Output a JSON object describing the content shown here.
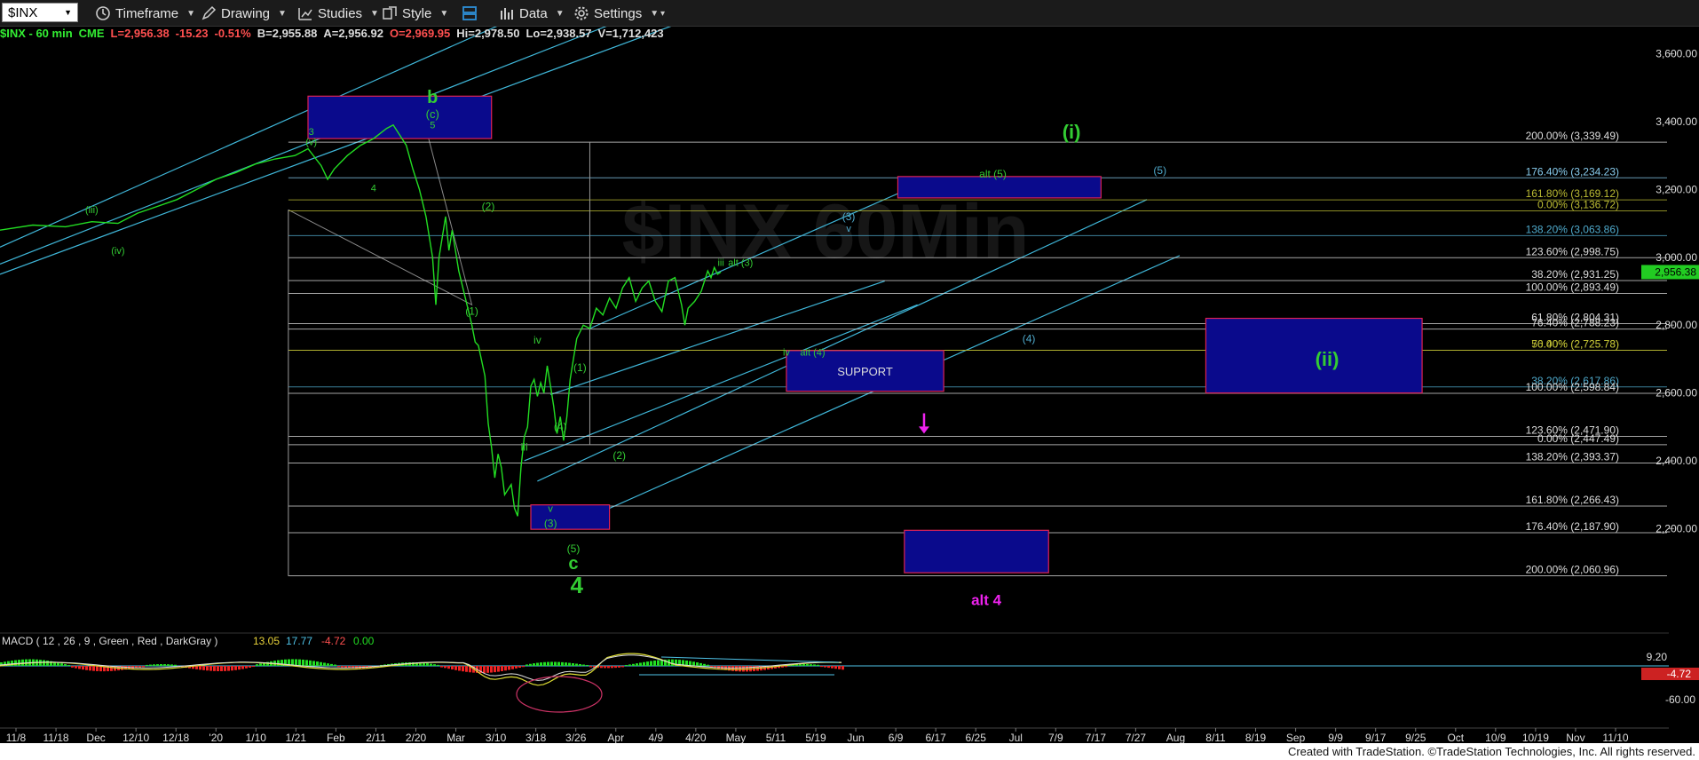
{
  "toolbar": {
    "symbol": "$INX",
    "items": [
      {
        "label": "Timeframe",
        "icon": "clock-icon"
      },
      {
        "label": "Drawing",
        "icon": "pencil-icon"
      },
      {
        "label": "Studies",
        "icon": "studies-icon"
      },
      {
        "label": "Style",
        "icon": "style-icon"
      },
      {
        "label": "Data",
        "icon": "data-icon"
      },
      {
        "label": "Settings",
        "icon": "gear-icon"
      }
    ]
  },
  "infobar": {
    "symbol": "$INX - 60 min",
    "exchange": "CME",
    "last": "L=2,956.38",
    "change": "-15.23",
    "pct": "-0.51%",
    "bid": "B=2,955.88",
    "ask": "A=2,956.92",
    "open": "O=2,969.95",
    "high": "Hi=2,978.50",
    "low": "Lo=2,938.57",
    "volume": "V=1,712,423",
    "colors": {
      "symbol": "#33ee33",
      "last": "#ff5050",
      "bid": "#dddddd",
      "open": "#ff5050"
    }
  },
  "watermark": "$INX 60Min",
  "footer": "Created with TradeStation. ©TradeStation Technologies, Inc. All rights reserved.",
  "macd": {
    "label": "MACD ( 12 , 26 , 9 , Green , Red , DarkGray )",
    "v1": "13.05",
    "v2": "17.77",
    "v3": "-4.72",
    "v4": "0.00",
    "axis_labels": [
      "9.20",
      "-60.00"
    ],
    "last_badge": "-4.72",
    "colors": {
      "line": "#dddd33",
      "signal": "#dddddd",
      "hist_pos": "#22dd22",
      "hist_neg": "#ee2222"
    }
  },
  "chart_data": {
    "type": "line",
    "y_axis": {
      "min": 1900,
      "max": 3680,
      "ticks": [
        2200,
        2400,
        2600,
        2800,
        3000,
        3200,
        3400,
        3600
      ],
      "tick_labels": [
        "2,200.00",
        "2,400.00",
        "2,600.00",
        "2,800.00",
        "3,000.00",
        "3,200.00",
        "3,400.00",
        "3,600.00"
      ]
    },
    "x_axis": {
      "tick_labels": [
        "11/8",
        "11/18",
        "Dec",
        "12/10",
        "12/18",
        "'20",
        "1/10",
        "1/21",
        "Feb",
        "2/11",
        "2/20",
        "Mar",
        "3/10",
        "3/18",
        "3/26",
        "Apr",
        "4/9",
        "4/20",
        "May",
        "5/11",
        "5/19",
        "Jun",
        "6/9",
        "6/17",
        "6/25",
        "Jul",
        "7/9",
        "7/17",
        "7/27",
        "Aug",
        "8/11",
        "8/19",
        "Sep",
        "9/9",
        "9/17",
        "9/25",
        "Oct",
        "10/9",
        "10/19",
        "Nov",
        "11/10"
      ]
    },
    "last_price": {
      "value": 2956.38,
      "label": "2,956.38",
      "color": "#22cc22"
    },
    "price_series": {
      "color": "#22dd22",
      "points": [
        [
          0,
          3080
        ],
        [
          5,
          3095
        ],
        [
          10,
          3090
        ],
        [
          14,
          3105
        ],
        [
          18,
          3100
        ],
        [
          21,
          3130
        ],
        [
          24,
          3150
        ],
        [
          27,
          3170
        ],
        [
          30,
          3200
        ],
        [
          33,
          3230
        ],
        [
          36,
          3250
        ],
        [
          39,
          3275
        ],
        [
          42,
          3290
        ],
        [
          45,
          3300
        ],
        [
          47,
          3320
        ],
        [
          49,
          3270
        ],
        [
          50,
          3230
        ],
        [
          51,
          3260
        ],
        [
          53,
          3300
        ],
        [
          55,
          3330
        ],
        [
          57,
          3350
        ],
        [
          59,
          3380
        ],
        [
          60,
          3390
        ],
        [
          61,
          3360
        ],
        [
          62,
          3330
        ],
        [
          63,
          3260
        ],
        [
          64,
          3200
        ],
        [
          65,
          3120
        ],
        [
          66,
          3000
        ],
        [
          66.5,
          2860
        ],
        [
          67,
          3000
        ],
        [
          68,
          3120
        ],
        [
          68.5,
          3020
        ],
        [
          69,
          3080
        ],
        [
          70,
          2960
        ],
        [
          71,
          2880
        ],
        [
          72,
          2800
        ],
        [
          72.5,
          2750
        ],
        [
          73,
          2740
        ],
        [
          74,
          2650
        ],
        [
          74.5,
          2510
        ],
        [
          75,
          2440
        ],
        [
          75.5,
          2350
        ],
        [
          76,
          2420
        ],
        [
          76.5,
          2380
        ],
        [
          77,
          2300
        ],
        [
          78,
          2330
        ],
        [
          78.5,
          2260
        ],
        [
          79,
          2237
        ],
        [
          79.5,
          2380
        ],
        [
          80,
          2470
        ],
        [
          80.5,
          2500
        ],
        [
          81,
          2620
        ],
        [
          81.5,
          2640
        ],
        [
          82,
          2590
        ],
        [
          82.5,
          2630
        ],
        [
          83,
          2600
        ],
        [
          83.5,
          2680
        ],
        [
          84,
          2620
        ],
        [
          84.5,
          2560
        ],
        [
          85,
          2480
        ],
        [
          85.5,
          2530
        ],
        [
          86,
          2460
        ],
        [
          86.5,
          2530
        ],
        [
          87,
          2640
        ],
        [
          88,
          2760
        ],
        [
          89,
          2800
        ],
        [
          90,
          2790
        ],
        [
          91,
          2850
        ],
        [
          92,
          2830
        ],
        [
          93,
          2880
        ],
        [
          94,
          2850
        ],
        [
          95,
          2910
        ],
        [
          96,
          2940
        ],
        [
          97,
          2870
        ],
        [
          98,
          2910
        ],
        [
          99,
          2930
        ],
        [
          100,
          2870
        ],
        [
          101,
          2840
        ],
        [
          102,
          2930
        ],
        [
          103,
          2940
        ],
        [
          104,
          2860
        ],
        [
          104.5,
          2800
        ],
        [
          105,
          2850
        ],
        [
          106,
          2870
        ],
        [
          107,
          2900
        ],
        [
          108,
          2960
        ],
        [
          108.5,
          2940
        ],
        [
          109,
          2970
        ],
        [
          109.5,
          2950
        ],
        [
          110,
          2956.38
        ]
      ]
    },
    "fib_levels": [
      {
        "label": "200.00% (3,339.49)",
        "value": 3339.49,
        "color": "#dddddd"
      },
      {
        "label": "176.40% (3,234.23)",
        "value": 3234.23,
        "color": "#88ccee"
      },
      {
        "label": "161.80% (3,169.12)",
        "value": 3169.12,
        "color": "#bbbb33"
      },
      {
        "label": "0.00% (3,136.72)",
        "value": 3136.72,
        "color": "#bbbb33"
      },
      {
        "label": "138.20% (3,063.86)",
        "value": 3063.86,
        "color": "#4faacc"
      },
      {
        "label": "123.60% (2,998.75)",
        "value": 2998.75,
        "color": "#dddddd"
      },
      {
        "label": "38.20% (2,931.25)",
        "value": 2931.25,
        "color": "#dddddd"
      },
      {
        "label": "100.00% (2,893.49)",
        "value": 2893.49,
        "color": "#dddddd"
      },
      {
        "label": "61.80% (2,804.31)",
        "value": 2804.31,
        "color": "#dddddd"
      },
      {
        "label": "76.40% (2,788.23)",
        "value": 2788.23,
        "color": "#dddddd"
      },
      {
        "label": "76.40% (2,725.73)",
        "value": 2725.73,
        "color": "#bbbb33"
      },
      {
        "label": "50.00% (2,725.78)",
        "value": 2725.78,
        "color": "#bbbb33"
      },
      {
        "label": "38.20% (2,617.86)",
        "value": 2617.86,
        "color": "#4faacc"
      },
      {
        "label": "100.00% (2,598.84)",
        "value": 2598.84,
        "color": "#dddddd"
      },
      {
        "label": "123.60% (2,471.90)",
        "value": 2471.9,
        "color": "#dddddd"
      },
      {
        "label": "0.00% (2,447.49)",
        "value": 2447.49,
        "color": "#dddddd"
      },
      {
        "label": "138.20% (2,393.37)",
        "value": 2393.37,
        "color": "#dddddd"
      },
      {
        "label": "161.80% (2,266.43)",
        "value": 2266.43,
        "color": "#dddddd"
      },
      {
        "label": "176.40% (2,187.90)",
        "value": 2187.9,
        "color": "#dddddd"
      },
      {
        "label": "200.00% (2,060.96)",
        "value": 2060.96,
        "color": "#dddddd"
      }
    ],
    "boxes": [
      {
        "name": "b-top-box",
        "x0": 47,
        "x1": 75,
        "y0": 3350,
        "y1": 3475,
        "label": ""
      },
      {
        "name": "alt5-target-box",
        "x0": 137,
        "x1": 168,
        "y0": 3175,
        "y1": 3238,
        "label": ""
      },
      {
        "name": "support-box",
        "x0": 120,
        "x1": 144,
        "y0": 2605,
        "y1": 2725,
        "label": "SUPPORT"
      },
      {
        "name": "wave-ii-box",
        "x0": 184,
        "x1": 217,
        "y0": 2600,
        "y1": 2820,
        "label": ""
      },
      {
        "name": "low-box",
        "x0": 81,
        "x1": 93,
        "y0": 2198,
        "y1": 2270,
        "label": ""
      },
      {
        "name": "alt4-box",
        "x0": 138,
        "x1": 160,
        "y0": 2070,
        "y1": 2195,
        "label": ""
      }
    ],
    "wave_labels": [
      {
        "text": "b",
        "x": 66,
        "y": 3455,
        "color": "#33cc33",
        "size": 20
      },
      {
        "text": "(c)",
        "x": 66,
        "y": 3410,
        "color": "#33cc33",
        "size": 13
      },
      {
        "text": "5",
        "x": 66,
        "y": 3380,
        "color": "#33cc33",
        "size": 11
      },
      {
        "text": "3",
        "x": 47.5,
        "y": 3360,
        "color": "#33cc33",
        "size": 11
      },
      {
        "text": "(v)",
        "x": 47.5,
        "y": 3330,
        "color": "#33cc33",
        "size": 11
      },
      {
        "text": "4",
        "x": 57,
        "y": 3195,
        "color": "#33cc33",
        "size": 11
      },
      {
        "text": "(iii)",
        "x": 14,
        "y": 3130,
        "color": "#33cc33",
        "size": 11
      },
      {
        "text": "(iv)",
        "x": 18,
        "y": 3010,
        "color": "#33cc33",
        "size": 11
      },
      {
        "text": "(2)",
        "x": 74.5,
        "y": 3140,
        "color": "#33cc33",
        "size": 12
      },
      {
        "text": "(1)",
        "x": 72,
        "y": 2830,
        "color": "#33cc33",
        "size": 12
      },
      {
        "text": "iv",
        "x": 82,
        "y": 2745,
        "color": "#33cc33",
        "size": 12
      },
      {
        "text": "(1)",
        "x": 88.5,
        "y": 2665,
        "color": "#33cc33",
        "size": 12
      },
      {
        "text": "(4)",
        "x": 85.5,
        "y": 2490,
        "color": "#33cc33",
        "size": 12
      },
      {
        "text": "iii",
        "x": 80,
        "y": 2430,
        "color": "#33cc33",
        "size": 12
      },
      {
        "text": "(2)",
        "x": 94.5,
        "y": 2405,
        "color": "#33cc33",
        "size": 12
      },
      {
        "text": "v",
        "x": 84,
        "y": 2250,
        "color": "#33cc33",
        "size": 11
      },
      {
        "text": "(3)",
        "x": 84,
        "y": 2205,
        "color": "#33cc33",
        "size": 12
      },
      {
        "text": "(5)",
        "x": 87.5,
        "y": 2130,
        "color": "#33cc33",
        "size": 12
      },
      {
        "text": "c",
        "x": 87.5,
        "y": 2080,
        "color": "#33cc33",
        "size": 20
      },
      {
        "text": "4",
        "x": 88,
        "y": 2010,
        "color": "#33cc33",
        "size": 26
      },
      {
        "text": "iii",
        "x": 110,
        "y": 2975,
        "color": "#33cc33",
        "size": 11
      },
      {
        "text": "alt (3)",
        "x": 113,
        "y": 2975,
        "color": "#33cc33",
        "size": 11
      },
      {
        "text": "iv",
        "x": 120,
        "y": 2710,
        "color": "#33cc33",
        "size": 11
      },
      {
        "text": "alt (4)",
        "x": 124,
        "y": 2710,
        "color": "#33cc33",
        "size": 11
      },
      {
        "text": "alt (5)",
        "x": 151.5,
        "y": 3235,
        "color": "#33cc33",
        "size": 12
      },
      {
        "text": "(i)",
        "x": 163.5,
        "y": 3350,
        "color": "#33cc33",
        "size": 22
      },
      {
        "text": "(ii)",
        "x": 202.5,
        "y": 2680,
        "color": "#33cc33",
        "size": 22
      },
      {
        "text": "(3)",
        "x": 129.5,
        "y": 3110,
        "color": "#4faacc",
        "size": 12
      },
      {
        "text": "v",
        "x": 129.5,
        "y": 3075,
        "color": "#4faacc",
        "size": 11
      },
      {
        "text": "(5)",
        "x": 177,
        "y": 3245,
        "color": "#4faacc",
        "size": 12
      },
      {
        "text": "(4)",
        "x": 157,
        "y": 2750,
        "color": "#4faacc",
        "size": 12
      },
      {
        "text": "alt 4",
        "x": 150.5,
        "y": 1975,
        "color": "#ee22ee",
        "size": 17
      }
    ],
    "x_range": [
      0,
      256
    ],
    "alt_arrow": {
      "x": 141,
      "y_from": 2540,
      "y_to": 2480,
      "color": "#ee22ee"
    }
  }
}
